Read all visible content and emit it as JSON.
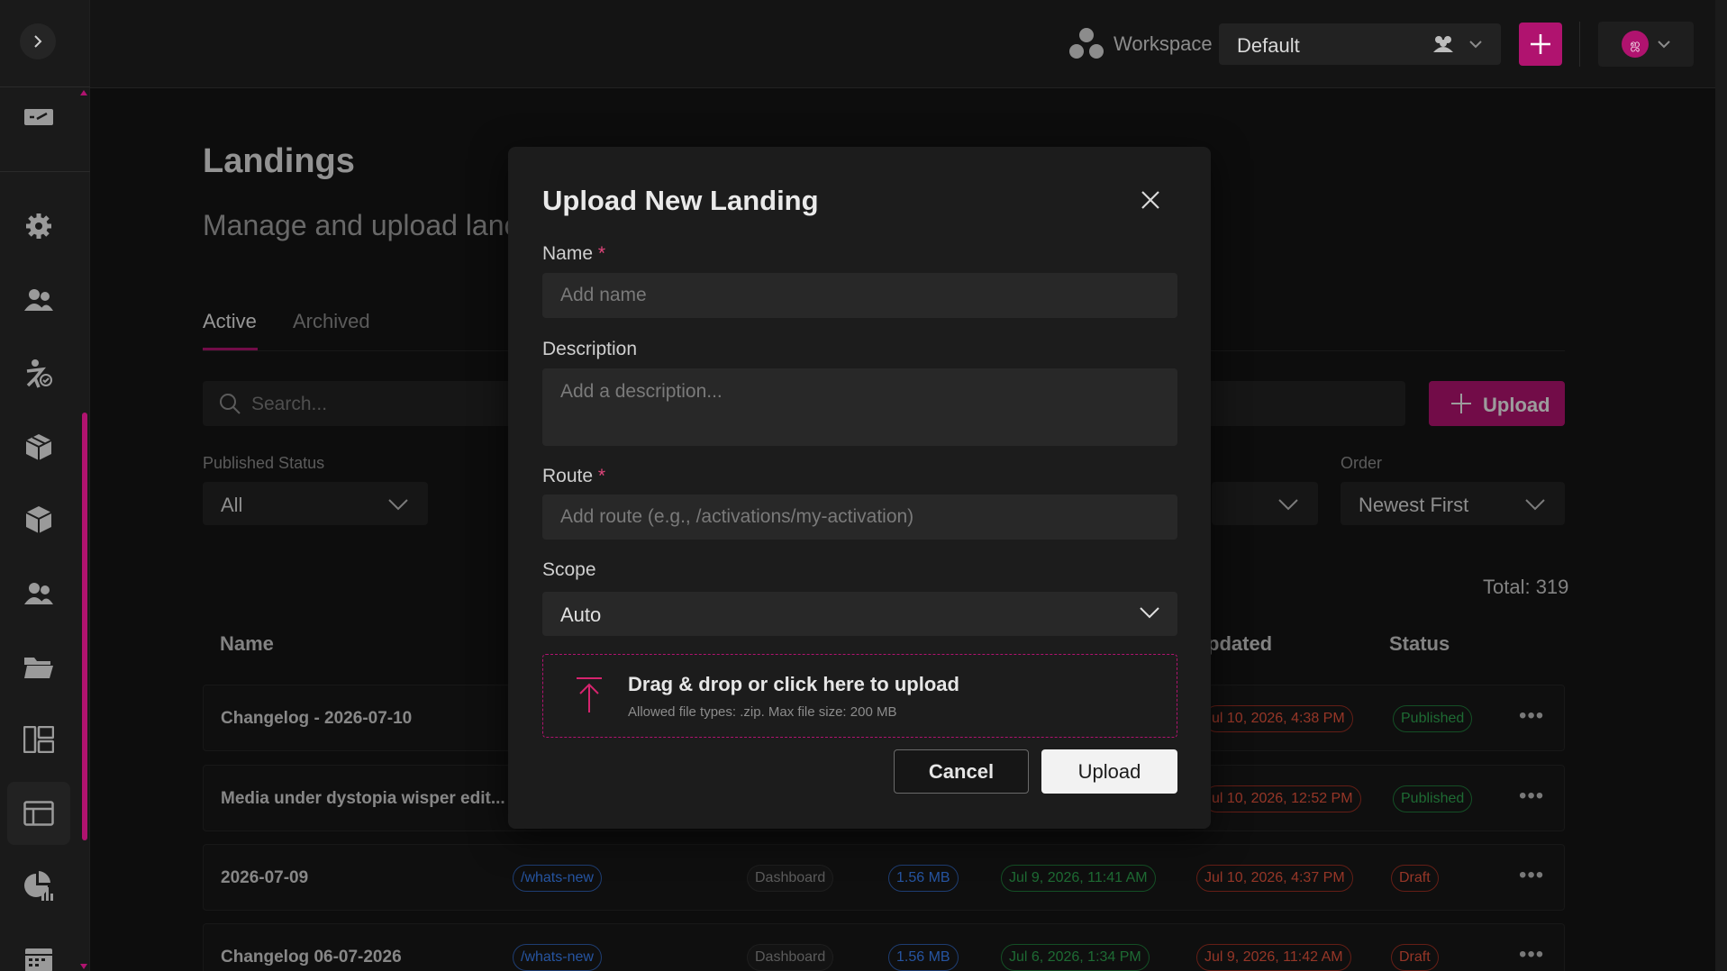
{
  "header": {
    "workspace_label": "Workspace",
    "workspace_value": "Default",
    "avatar_initials": "ஜ"
  },
  "sidebar": {
    "items": [
      {
        "icon": "ticket-icon"
      },
      {
        "icon": "gear-icon"
      },
      {
        "icon": "users-icon"
      },
      {
        "icon": "activity-icon"
      },
      {
        "icon": "boxes-icon"
      },
      {
        "icon": "cube-icon"
      },
      {
        "icon": "team-icon"
      },
      {
        "icon": "folder-icon"
      },
      {
        "icon": "layout-icon"
      },
      {
        "icon": "landing-icon",
        "active": true
      },
      {
        "icon": "analytics-icon"
      },
      {
        "icon": "calendar-icon"
      }
    ]
  },
  "page": {
    "title": "Landings",
    "subtitle": "Manage and upload lanc",
    "tabs": [
      "Active",
      "Archived"
    ],
    "search_placeholder": "Search...",
    "upload_label": "Upload",
    "filters": {
      "published_status_label": "Published Status",
      "published_status_value": "All",
      "order_label": "Order",
      "order_value": "Newest First"
    },
    "total": "Total: 319",
    "columns": {
      "name": "Name",
      "updated": "pdated",
      "status": "Status"
    },
    "rows": [
      {
        "name": "Changelog - 2026-07-10",
        "route": "",
        "type": "",
        "size": "",
        "created": "",
        "updated": "ul 10, 2026, 4:38 PM",
        "status": "Published"
      },
      {
        "name": "Media under dystopia wisper edit...",
        "route": "",
        "type": "",
        "size": "",
        "created": "",
        "updated": "ul 10, 2026, 12:52 PM",
        "status": "Published"
      },
      {
        "name": "2026-07-09",
        "route": "/whats-new",
        "type": "Dashboard",
        "size": "1.56 MB",
        "created": "Jul 9, 2026, 11:41 AM",
        "updated": "Jul 10, 2026, 4:37 PM",
        "status": "Draft"
      },
      {
        "name": "Changelog 06-07-2026",
        "route": "/whats-new",
        "type": "Dashboard",
        "size": "1.56 MB",
        "created": "Jul 6, 2026, 1:34 PM",
        "updated": "Jul 9, 2026, 11:42 AM",
        "status": "Draft"
      }
    ]
  },
  "modal": {
    "title": "Upload New Landing",
    "name_label": "Name",
    "name_placeholder": "Add name",
    "description_label": "Description",
    "description_placeholder": "Add a description...",
    "route_label": "Route",
    "route_placeholder": "Add route (e.g., /activations/my-activation)",
    "scope_label": "Scope",
    "scope_value": "Auto",
    "required_marker": "*",
    "dropzone_title": "Drag & drop or click here to upload",
    "dropzone_subtitle": "Allowed file types: .zip. Max file size: 200 MB",
    "cancel_label": "Cancel",
    "upload_label": "Upload"
  },
  "colors": {
    "accent": "#b0136f",
    "published": "#2ea44f",
    "draft": "#e5533d",
    "info": "#3b82f6"
  }
}
